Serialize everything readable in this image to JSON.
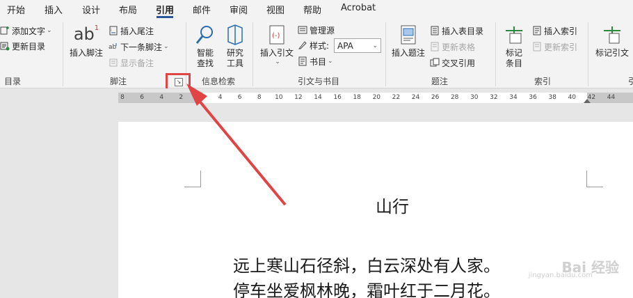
{
  "tabs": [
    "开始",
    "插入",
    "设计",
    "布局",
    "引用",
    "邮件",
    "审阅",
    "视图",
    "帮助",
    "Acrobat"
  ],
  "active_tab": "引用",
  "ribbon": {
    "toc": {
      "add_text": "添加文字",
      "update_toc": "更新目录",
      "group_label": "目录"
    },
    "footnotes": {
      "insert_footnote_line1": "插入脚注",
      "insert_endnote": "插入尾注",
      "next_footnote": "下一条脚注",
      "show_notes": "显示备注",
      "group_label": "脚注",
      "ab_glyph": "ab",
      "ab_sup": "1"
    },
    "research": {
      "smart_lookup_1": "智能",
      "smart_lookup_2": "查找",
      "researcher_1": "研究",
      "researcher_2": "工具",
      "group_label": "信息检索"
    },
    "citations": {
      "insert_citation": "插入引文",
      "manage_sources": "管理源",
      "style_label": "样式:",
      "style_value": "APA",
      "bibliography": "书目",
      "group_label": "引文与书目"
    },
    "captions": {
      "insert_caption": "插入题注",
      "insert_table_of_figures": "插入表目录",
      "update_table": "更新表格",
      "cross_reference": "交叉引用",
      "group_label": "题注"
    },
    "index": {
      "mark_entry_1": "标记",
      "mark_entry_2": "条目",
      "insert_index": "插入索引",
      "update_index": "更新索引",
      "group_label": "索引"
    },
    "toa": {
      "mark_citation": "标记引文",
      "group_label_partial": "引"
    }
  },
  "ruler": {
    "numbers": [
      "8",
      "6",
      "4",
      "2",
      "2",
      "4",
      "6",
      "8",
      "10",
      "12",
      "14",
      "16",
      "18",
      "20",
      "22",
      "24",
      "26",
      "28",
      "30",
      "32",
      "34",
      "36",
      "38",
      "40",
      "42",
      "44"
    ]
  },
  "document": {
    "title": "山行",
    "lines": [
      "远上寒山石径斜，白云深处有人家。",
      "停车坐爱枫林晚，霜叶红于二月花。"
    ]
  },
  "watermark": {
    "main": "Bai 经验",
    "sub": "jingyan.baidu.com"
  },
  "colors": {
    "accent": "#2b579a",
    "annotation": "#e04444"
  }
}
